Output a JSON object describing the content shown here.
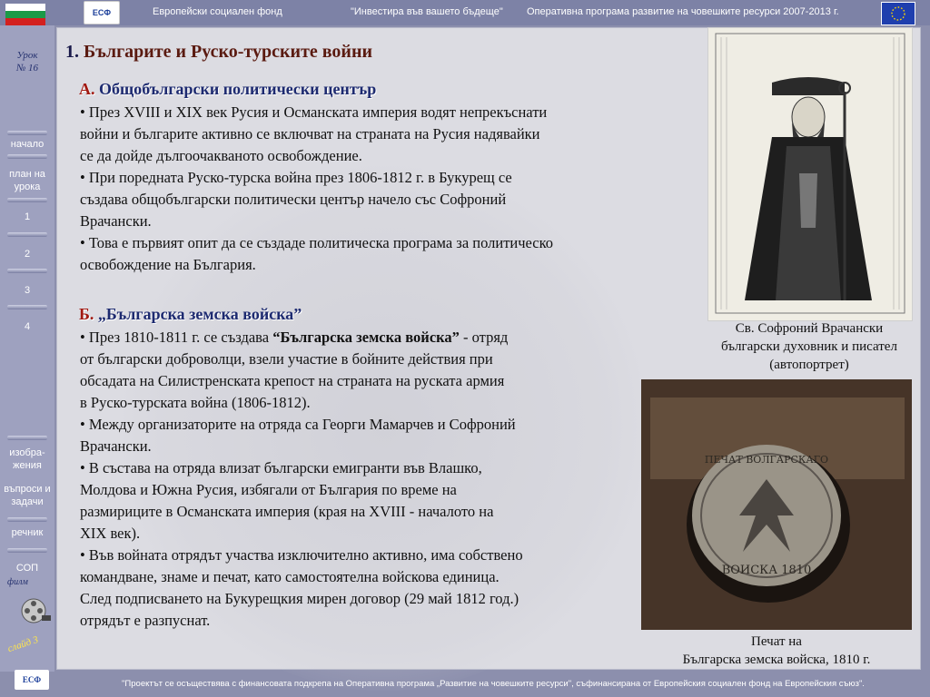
{
  "header": {
    "logo_text": "ЕСФ",
    "fund": "Европейски социален фонд",
    "motto": "\"Инвестира във вашето бъдеще\"",
    "program": "Оперативна програма развитие на човешките ресурси 2007-2013 г."
  },
  "sidebar": {
    "lesson_label": "Урок",
    "lesson_number": "№ 16",
    "items": [
      {
        "label": "начало"
      },
      {
        "label": "план на урока"
      },
      {
        "label": "1"
      },
      {
        "label": "2"
      },
      {
        "label": "3"
      },
      {
        "label": "4"
      },
      {
        "label": "изобра-жения"
      },
      {
        "label": "въпроси и задачи"
      },
      {
        "label": "речник"
      },
      {
        "label": "СОП"
      }
    ],
    "film_label": "филм",
    "slide_label": "слайд 3",
    "bottom_logo": "ЕСФ"
  },
  "main": {
    "title_number": "1.",
    "title_text": "Българите и Руско-турските войни",
    "section_a": {
      "letter": "А.",
      "heading": "Общобългарски политически център",
      "p1": "• През XVIII и XIX век Русия и Османската империя водят непрекъснати\n  войни и българите активно се включват на страната на Русия надявайки\n  се да дойде дългоочакваното освобождение.",
      "p2": "• При поредната Руско-турска война през 1806-1812 г. в Букурещ се\n  създава общобългарски политически център начело със Софроний\n  Врачански.",
      "p3": "• Това е първият опит да се създаде политическа програма за политическо\n  освобождение на България."
    },
    "section_b": {
      "letter": "Б.",
      "heading": "„Българска земска войска”",
      "p1_pre": "• През 1810-1811 г. се създава ",
      "p1_bold": "“Българска земска войска”",
      "p1_post": " - отряд\n  от български доброволци, взели участие в бойните действия при\n  обсадата на Силистренската крепост на страната на руската армия\n  в Руско-турската война (1806-1812).",
      "p2": "• Между организаторите на отряда са Георги Мамарчев и Софроний\n  Врачански.",
      "p3": "• В състава на отряда влизат български емигранти във Влашко,\n   Молдова и Южна Русия, избягали от България по време на\n   размириците в Османската империя (края на XVIII - началото на\n   XIX век).",
      "p4": "• Във войната отрядът участва изключително активно, има собствено\n  командване, знаме и печат, като самостоятелна войскова единица.\n  След подписването на Букурещкия мирен договор (29 май 1812 год.)\n  отрядът е разпуснат."
    }
  },
  "figures": {
    "portrait_caption": "Св. Софроний Врачански\nбългарски духовник и писател\n(автопортрет)",
    "seal_caption": "Печат на\nБългарска земска войска, 1810 г.",
    "seal_text_top": "ПЕЧАТ ВОЛГАРСКАГО",
    "seal_text_bottom": "ВОИСКА 1810"
  },
  "footer": {
    "text": "\"Проектът се осъществява с финансовата подкрепа на  Оперативна програма „Развитие на човешките ресурси\", съфинансирана от Европейския социален фонд на Европейския съюз\"."
  },
  "colors": {
    "frame": "#8c8fad",
    "panel": "#dcdce2",
    "title": "#5a1a10",
    "heading": "#1d2a70",
    "letter": "#a21a12"
  }
}
